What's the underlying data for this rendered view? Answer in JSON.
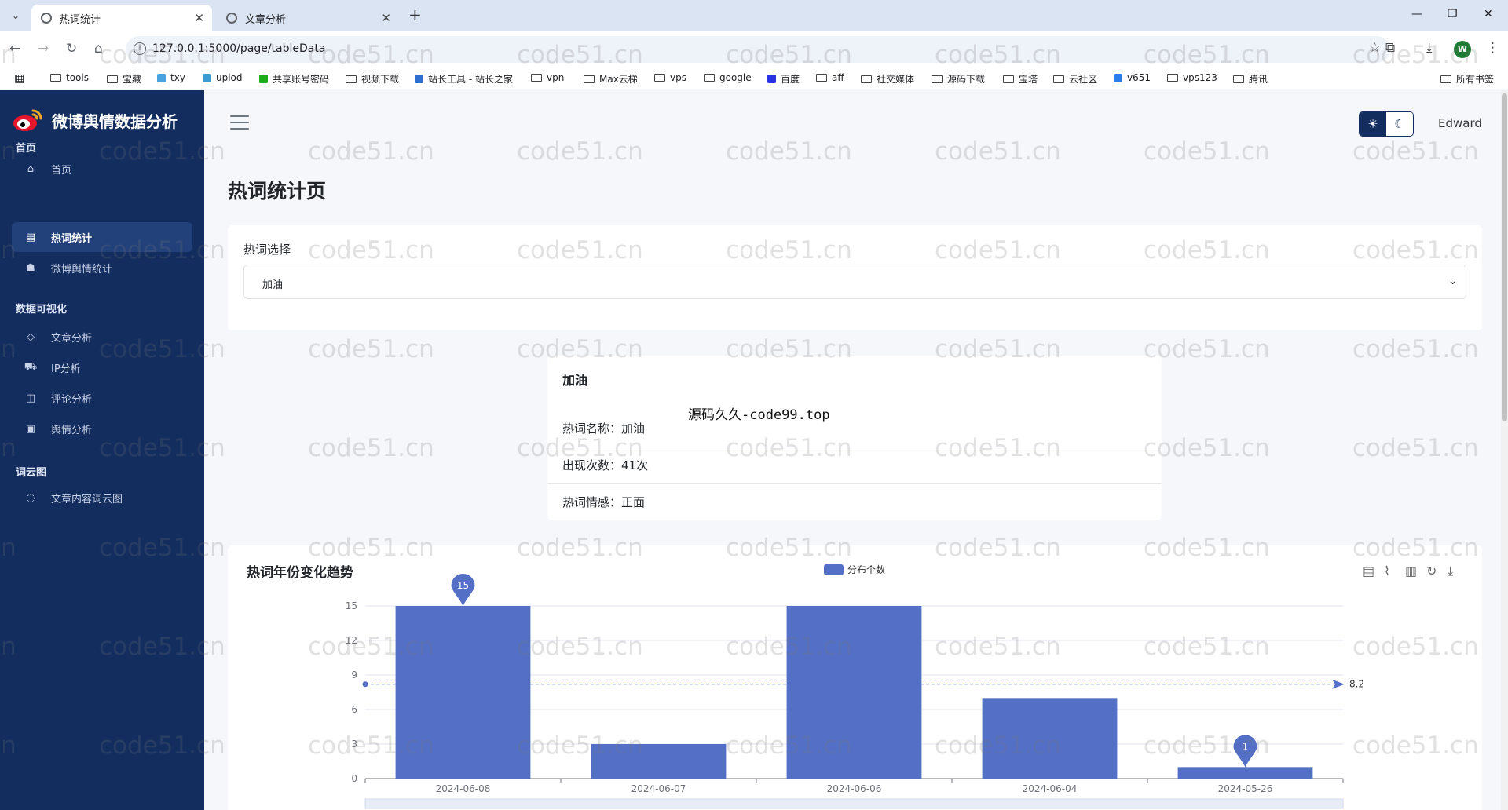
{
  "browser": {
    "tabs": [
      {
        "title": "热词统计",
        "active": true
      },
      {
        "title": "文章分析",
        "active": false
      }
    ],
    "url": "127.0.0.1:5000/page/tableData",
    "profile_initial": "W",
    "bookmarks": [
      "tools",
      "宝藏",
      "txy",
      "uplod",
      "共享账号密码",
      "视频下载",
      "站长工具 - 站长之家",
      "vpn",
      "Max云梯",
      "vps",
      "google",
      "百度",
      "aff",
      "社交媒体",
      "源码下载",
      "宝塔",
      "云社区",
      "v651",
      "vps123",
      "腾讯"
    ],
    "all_bookmarks": "所有书签"
  },
  "sidebar": {
    "brand": "微博舆情数据分析",
    "sections": [
      {
        "title": "首页",
        "items": [
          {
            "label": "首页",
            "icon": "home-icon"
          },
          {
            "label": "热词统计",
            "icon": "table-icon",
            "active": true
          },
          {
            "label": "微博舆情统计",
            "icon": "users-icon"
          }
        ]
      },
      {
        "title": "数据可视化",
        "items": [
          {
            "label": "文章分析",
            "icon": "tag-icon"
          },
          {
            "label": "IP分析",
            "icon": "cart-icon"
          },
          {
            "label": "评论分析",
            "icon": "chart-box-icon"
          },
          {
            "label": "舆情分析",
            "icon": "clipboard-icon"
          }
        ]
      },
      {
        "title": "词云图",
        "items": [
          {
            "label": "文章内容词云图",
            "icon": "message-icon"
          }
        ]
      }
    ]
  },
  "header": {
    "user": "Edward"
  },
  "page": {
    "title": "热词统计页",
    "select_label": "热词选择",
    "select_value": "加油"
  },
  "detail": {
    "title": "加油",
    "rows": [
      "热词名称：加油",
      "出现次数：41次",
      "热词情感：正面"
    ],
    "overlay": "源码久久-code99.top"
  },
  "trend": {
    "title": "热词年份变化趋势"
  },
  "watermark": "code51.cn",
  "colors": {
    "sidebar": "#132d5f",
    "bar": "#5470c6"
  },
  "chart_data": {
    "type": "bar",
    "categories": [
      "2024-06-08",
      "2024-06-07",
      "2024-06-06",
      "2024-06-04",
      "2024-05-26"
    ],
    "series": [
      {
        "name": "分布个数",
        "values": [
          15,
          3,
          15,
          7,
          1
        ]
      }
    ],
    "ylim": [
      0,
      15
    ],
    "yticks": [
      0,
      3,
      6,
      9,
      12,
      15
    ],
    "mark_points": [
      {
        "label": "15",
        "category": "2024-06-08"
      },
      {
        "label": "1",
        "category": "2024-05-26"
      }
    ],
    "mark_line": {
      "type": "average",
      "value": 8.2,
      "label": "8.2"
    },
    "legend": "top-center",
    "grid": true
  }
}
